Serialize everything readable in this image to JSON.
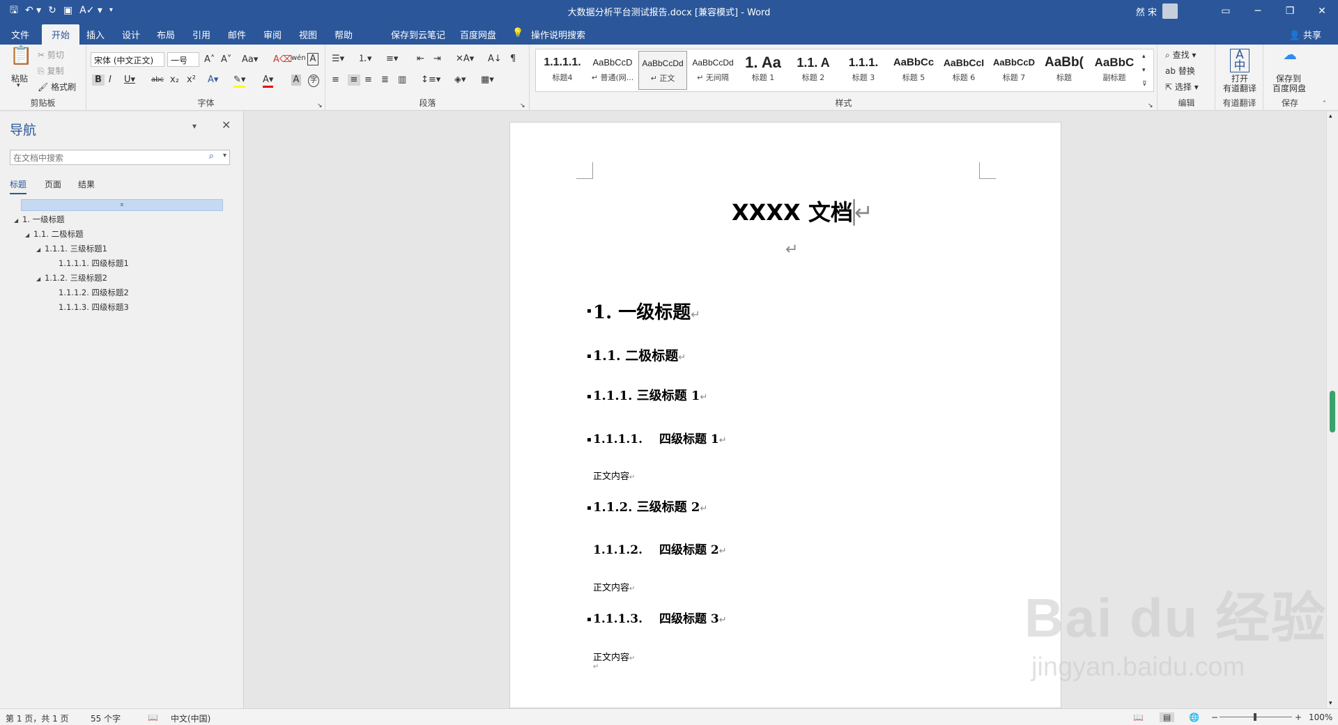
{
  "titlebar": {
    "title": "大数据分析平台测试报告.docx [兼容模式]  -  Word",
    "user": "然 宋",
    "qat": [
      "save-icon",
      "undo-icon",
      "redo-icon",
      "touch-icon",
      "spelling-icon",
      "customize-icon"
    ]
  },
  "menu": {
    "tabs": [
      "文件",
      "开始",
      "插入",
      "设计",
      "布局",
      "引用",
      "邮件",
      "审阅",
      "视图",
      "帮助",
      "保存到云笔记",
      "百度网盘"
    ],
    "tellme": "操作说明搜索",
    "share": "共享"
  },
  "ribbon": {
    "clipboard": {
      "paste": "粘贴",
      "cut": "剪切",
      "copy": "复制",
      "format_painter": "格式刷",
      "label": "剪贴板"
    },
    "font": {
      "name": "宋体 (中文正文)",
      "size": "一号",
      "label": "字体"
    },
    "paragraph": {
      "label": "段落"
    },
    "styles": {
      "items": [
        {
          "preview": "1.1.1.1.",
          "name": "标题4"
        },
        {
          "preview": "AaBbCcD",
          "name": "↵ 普通(网..."
        },
        {
          "preview": "AaBbCcDd",
          "name": "↵ 正文"
        },
        {
          "preview": "AaBbCcDd",
          "name": "↵ 无间隔"
        },
        {
          "preview": "1. Aa",
          "name": "标题 1"
        },
        {
          "preview": "1.1. A",
          "name": "标题 2"
        },
        {
          "preview": "1.1.1.",
          "name": "标题 3"
        },
        {
          "preview": "AaBbCc",
          "name": "标题 5"
        },
        {
          "preview": "AaBbCcI",
          "name": "标题 6"
        },
        {
          "preview": "AaBbCcD",
          "name": "标题 7"
        },
        {
          "preview": "AaBb(",
          "name": "标题"
        },
        {
          "preview": "AaBbC",
          "name": "副标题"
        }
      ],
      "label": "样式"
    },
    "editing": {
      "find": "查找",
      "replace": "替换",
      "select": "选择",
      "label": "编辑"
    },
    "youdao": {
      "open": "打开",
      "translate": "有道翻译",
      "label": "有道翻译"
    },
    "baidu": {
      "save": "保存到",
      "disk": "百度网盘",
      "label": "保存"
    }
  },
  "nav": {
    "title": "导航",
    "search_placeholder": "在文档中搜索",
    "tabs": [
      "标题",
      "页面",
      "结果"
    ],
    "tree": [
      {
        "text": "1. 一级标题",
        "level": 0,
        "expand": true
      },
      {
        "text": "1.1. 二极标题",
        "level": 1,
        "expand": true
      },
      {
        "text": "1.1.1. 三级标题1",
        "level": 2,
        "expand": true
      },
      {
        "text": "1.1.1.1. 四级标题1",
        "level": 3,
        "expand": false
      },
      {
        "text": "1.1.2. 三级标题2",
        "level": 2,
        "expand": true
      },
      {
        "text": "1.1.1.2. 四级标题2",
        "level": 3,
        "expand": false
      },
      {
        "text": "1.1.1.3. 四级标题3",
        "level": 3,
        "expand": false
      }
    ]
  },
  "document": {
    "title": "XXXX 文档",
    "h1": "1. 一级标题",
    "h2": "1.1. 二极标题",
    "h3a": "1.1.1.  三级标题 1",
    "h4a_num": "1.1.1.1.",
    "h4a_text": "四级标题 1",
    "body1": "正文内容",
    "h3b": "1.1.2.  三级标题 2",
    "h4b_num": "1.1.1.2.",
    "h4b_text": "四级标题 2",
    "body2": "正文内容",
    "h4c_num": "1.1.1.3.",
    "h4c_text": "四级标题 3",
    "body3": "正文内容",
    "para_mark": "↵"
  },
  "status": {
    "page": "第 1 页，共 1 页",
    "words": "55 个字",
    "lang": "中文(中国)",
    "zoom": "100%"
  },
  "watermark": {
    "brand": "Bai du 经验",
    "url": "jingyan.baidu.com"
  }
}
